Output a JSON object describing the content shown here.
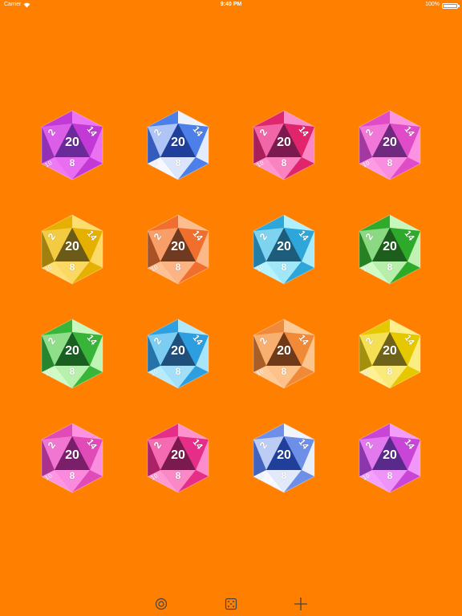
{
  "status_bar": {
    "carrier": "Carrier",
    "time": "9:40 PM",
    "battery_label": "100%",
    "battery_level": 1.0
  },
  "dice": {
    "labels": {
      "top": "20",
      "left": "2",
      "right": "14",
      "bottom": "8",
      "faint": "10"
    },
    "items": [
      {
        "light": "#f07cf7",
        "mid": "#c23ad6",
        "dark": "#6b2a9a"
      },
      {
        "light": "#ffffff",
        "mid": "#4d7fe8",
        "dark": "#1f3f9a"
      },
      {
        "light": "#ff9ad6",
        "mid": "#e0266d",
        "dark": "#7a1a4e"
      },
      {
        "light": "#ff9fe6",
        "mid": "#e04bc8",
        "dark": "#6f2a7f"
      },
      {
        "light": "#ffe27a",
        "mid": "#e5b000",
        "dark": "#6b5a18"
      },
      {
        "light": "#ffc59a",
        "mid": "#f06f2e",
        "dark": "#6f3a20"
      },
      {
        "light": "#bff7ff",
        "mid": "#2fa6d9",
        "dark": "#1d5c7a"
      },
      {
        "light": "#d8ffcc",
        "mid": "#2faa2a",
        "dark": "#1e5e1c"
      },
      {
        "light": "#d8ffcc",
        "mid": "#39b53a",
        "dark": "#1a5e22"
      },
      {
        "light": "#bff0ff",
        "mid": "#2e9fe0",
        "dark": "#1f4f7a"
      },
      {
        "light": "#ffcf9e",
        "mid": "#f08a3a",
        "dark": "#6f3a1a"
      },
      {
        "light": "#fff39a",
        "mid": "#e6c800",
        "dark": "#6f621a"
      },
      {
        "light": "#ff9ae6",
        "mid": "#e04bb8",
        "dark": "#7a1f6a"
      },
      {
        "light": "#ff9fd6",
        "mid": "#e62d88",
        "dark": "#7a1a4e"
      },
      {
        "light": "#ffffff",
        "mid": "#6d8fe8",
        "dark": "#1f3f9a"
      },
      {
        "light": "#f7a6ff",
        "mid": "#c845d8",
        "dark": "#5a2a8a"
      }
    ]
  },
  "toolbar": {
    "icons": [
      "settings-ring-icon",
      "dice-icon",
      "add-icon"
    ]
  }
}
